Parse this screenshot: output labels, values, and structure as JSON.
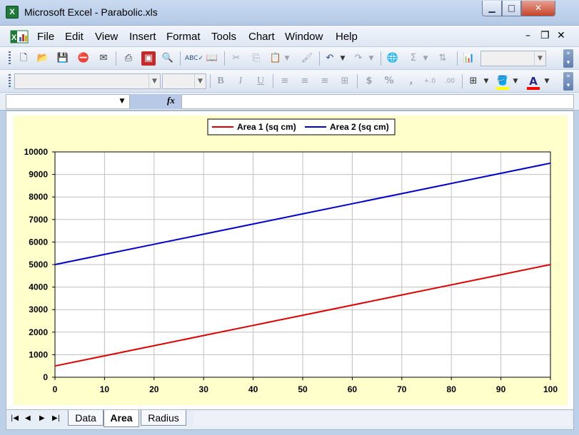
{
  "window": {
    "title": "Microsoft Excel - Parabolic.xls",
    "app_icon": "excel-icon",
    "min_glyph": "▁",
    "max_glyph": "□",
    "close_glyph": "✕"
  },
  "menu": {
    "items": [
      {
        "label": "File"
      },
      {
        "label": "Edit"
      },
      {
        "label": "View"
      },
      {
        "label": "Insert"
      },
      {
        "label": "Format"
      },
      {
        "label": "Tools"
      },
      {
        "label": "Chart"
      },
      {
        "label": "Window"
      },
      {
        "label": "Help"
      }
    ],
    "doc_min": "–",
    "doc_restore": "❐",
    "doc_close": "✕"
  },
  "toolbar_standard": {
    "icons": [
      "new-icon",
      "open-icon",
      "save-icon",
      "permission-icon",
      "email-icon",
      "print-icon",
      "research-icon",
      "print-preview-icon",
      "spelling-icon",
      "research-book-icon",
      "cut-icon",
      "copy-icon",
      "paste-icon",
      "format-painter-icon",
      "undo-icon",
      "redo-icon",
      "hyperlink-icon",
      "autosum-icon",
      "sort-icon",
      "chart-wizard-icon"
    ],
    "zoom_value": ""
  },
  "toolbar_formatting": {
    "font_value": "",
    "size_value": "",
    "bold": "B",
    "italic": "I",
    "underline": "U",
    "currency": "$",
    "percent": "%",
    "comma": ",",
    "inc_decimal": "+.0",
    "dec_decimal": ".00",
    "font_color_letter": "A",
    "fill_color": "#ffff00",
    "font_color": "#ff0000"
  },
  "formula_bar": {
    "name_box": "",
    "fx_label": "fx",
    "formula": ""
  },
  "chart_data": {
    "type": "line",
    "title": "",
    "xlabel": "",
    "ylabel": "",
    "x": [
      0,
      10,
      20,
      30,
      40,
      50,
      60,
      70,
      80,
      90,
      100
    ],
    "xlim": [
      0,
      100
    ],
    "ylim": [
      0,
      10000
    ],
    "xticks": [
      0,
      10,
      20,
      30,
      40,
      50,
      60,
      70,
      80,
      90,
      100
    ],
    "yticks": [
      0,
      1000,
      2000,
      3000,
      4000,
      5000,
      6000,
      7000,
      8000,
      9000,
      10000
    ],
    "grid": true,
    "legend_position": "top-center",
    "series": [
      {
        "name": "Area 1 (sq cm)",
        "color": "#dd0000",
        "values": [
          500,
          950,
          1400,
          1850,
          2300,
          2750,
          3200,
          3650,
          4100,
          4550,
          5000
        ]
      },
      {
        "name": "Area 2 (sq cm)",
        "color": "#0000cc",
        "values": [
          5000,
          5450,
          5900,
          6350,
          6800,
          7250,
          7700,
          8150,
          8600,
          9050,
          9500
        ]
      }
    ]
  },
  "sheets": {
    "tabs": [
      {
        "label": "Data",
        "active": false
      },
      {
        "label": "Area",
        "active": true
      },
      {
        "label": "Radius",
        "active": false
      }
    ],
    "nav": [
      "|◀",
      "◀",
      "▶",
      "▶|"
    ]
  }
}
